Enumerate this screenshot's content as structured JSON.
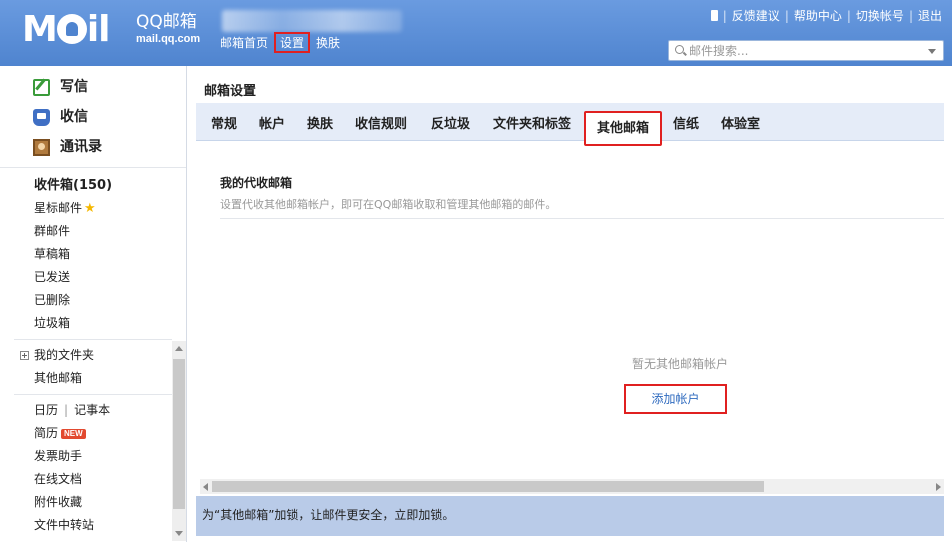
{
  "header": {
    "logo_text": "M",
    "logo_text2": "il",
    "brand_title": "QQ邮箱",
    "brand_domain": "mail.qq.com",
    "nav": [
      "邮箱首页",
      "设置",
      "换肤"
    ],
    "links": [
      "反馈建议",
      "帮助中心",
      "切换帐号",
      "退出"
    ],
    "search_placeholder": "邮件搜索..."
  },
  "sidebar": {
    "quick": [
      "写信",
      "收信",
      "通讯录"
    ],
    "folders": [
      "收件箱(150)",
      "星标邮件",
      "群邮件",
      "草稿箱",
      "已发送",
      "已删除",
      "垃圾箱"
    ],
    "my_folders": "我的文件夹",
    "other_mailbox": "其他邮箱",
    "calendar": "日历",
    "notebook": "记事本",
    "tools": [
      "简历",
      "发票助手",
      "在线文档",
      "附件收藏",
      "文件中转站"
    ],
    "new_badge": "NEW"
  },
  "main": {
    "title": "邮箱设置",
    "tabs": [
      "常规",
      "帐户",
      "换肤",
      "收信规则",
      "反垃圾",
      "文件夹和标签",
      "其他邮箱",
      "信纸",
      "体验室"
    ],
    "section_heading": "我的代收邮箱",
    "section_desc": "设置代收其他邮箱帐户，即可在QQ邮箱收取和管理其他邮箱的邮件。",
    "empty_text": "暂无其他邮箱帐户",
    "add_account": "添加帐户",
    "notice": "为“其他邮箱”加锁，让邮件更安全，立即加锁。"
  }
}
